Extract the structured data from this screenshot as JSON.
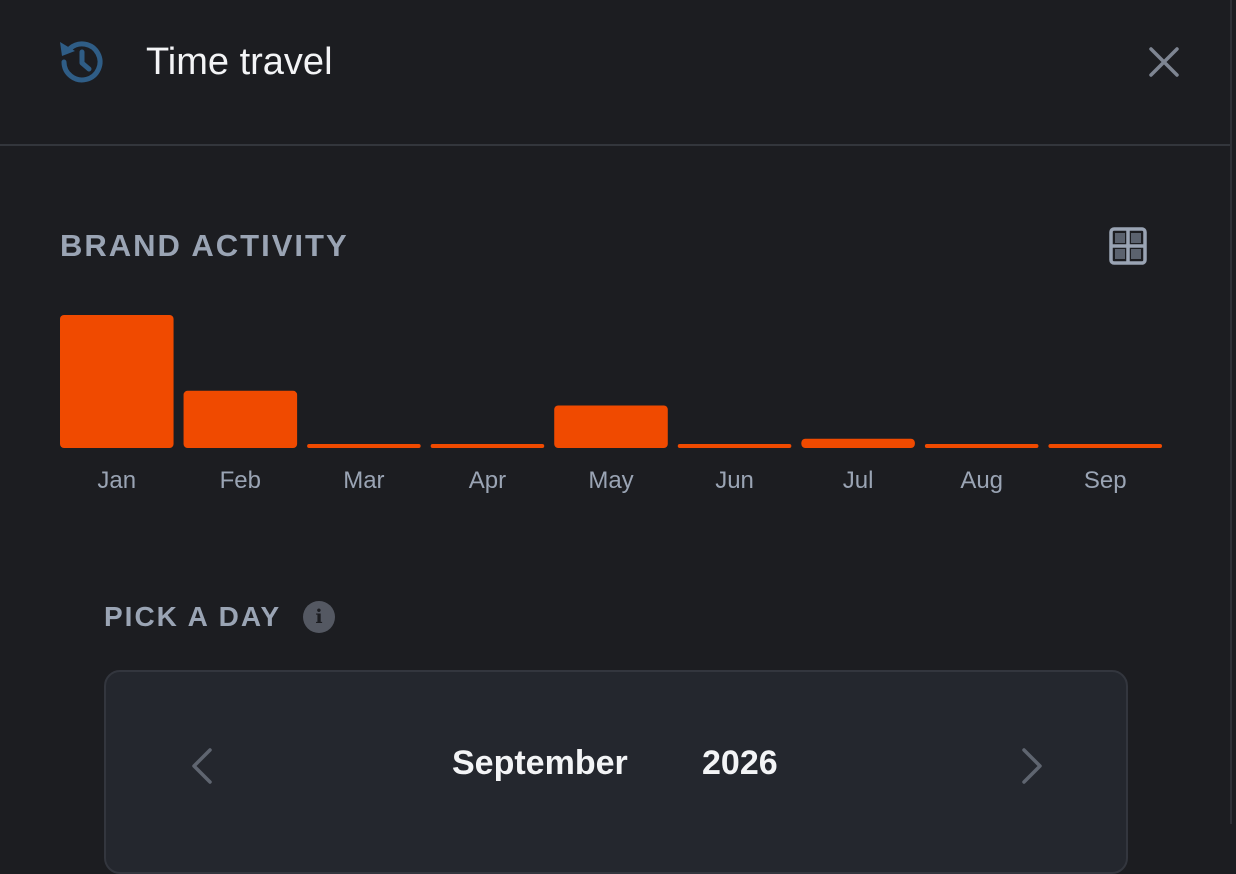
{
  "header": {
    "title": "Time travel",
    "icon": "history-icon",
    "close_icon": "close-icon"
  },
  "activity": {
    "label": "BRAND ACTIVITY",
    "view_icon": "grid-view-icon"
  },
  "chart_data": {
    "type": "bar",
    "categories": [
      "Jan",
      "Feb",
      "Mar",
      "Apr",
      "May",
      "Jun",
      "Jul",
      "Aug",
      "Sep"
    ],
    "values": [
      100,
      43,
      3,
      3,
      32,
      3,
      7,
      3,
      3
    ],
    "title": "",
    "xlabel": "",
    "ylabel": "",
    "grid": false,
    "bar_color": "#f04a00"
  },
  "pick_day": {
    "label": "PICK A DAY",
    "info_icon": "info-icon",
    "info_glyph": "i"
  },
  "calendar": {
    "month": "September",
    "year": "2026",
    "prev_icon": "chevron-left-icon",
    "next_icon": "chevron-right-icon"
  },
  "colors": {
    "background": "#1c1d21",
    "accent": "#f04a00",
    "muted_text": "#9aa4b4",
    "history_icon": "#2f5d86"
  }
}
